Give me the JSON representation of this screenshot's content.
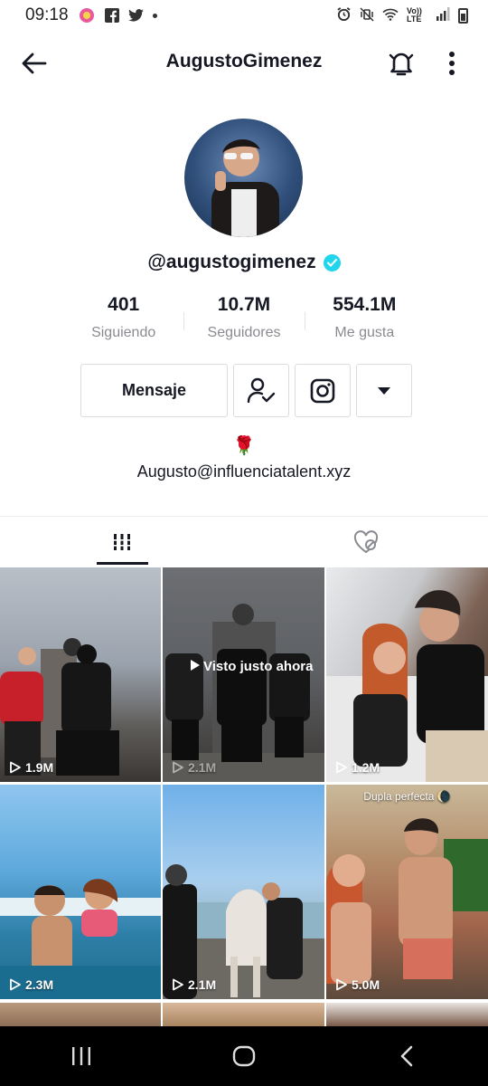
{
  "status_bar": {
    "time": "09:18",
    "network": "Vo)) LTE"
  },
  "header": {
    "title": "AugustoGimenez"
  },
  "profile": {
    "handle": "@augustogimenez",
    "verified": true
  },
  "stats": [
    {
      "value": "401",
      "label": "Siguiendo"
    },
    {
      "value": "10.7M",
      "label": "Seguidores"
    },
    {
      "value": "554.1M",
      "label": "Me gusta"
    }
  ],
  "actions": {
    "message_label": "Mensaje"
  },
  "bio": {
    "emoji": "🌹",
    "email": "Augusto@influenciatalent.xyz"
  },
  "videos": [
    {
      "views": "1.9M",
      "bg": "linear-gradient(180deg,#b9bfc7 0%,#9aa2ad 45%,#5d5b58 75%,#3a3633 100%)"
    },
    {
      "views": "2.1M",
      "bg": "linear-gradient(180deg,#a7aab0 0%,#8f9399 50%,#6e6c6a 80%,#5b5856 100%)",
      "watched_text": "Visto justo ahora"
    },
    {
      "views": "1.2M",
      "bg": "linear-gradient(120deg,#e8eaec 0%,#c7c9cc 35%,#7d6355 60%,#3b2e29 100%)"
    },
    {
      "views": "2.3M",
      "bg": "linear-gradient(180deg,#8fc6ef 0%,#5ea9dc 40%,#2e7fa8 70%,#1f6b8c 100%)"
    },
    {
      "views": "2.1M",
      "bg": "linear-gradient(180deg,#6fb0e8 0%,#a9cfee 45%,#9bb7c8 65%,#4a4d52 100%)"
    },
    {
      "views": "5.0M",
      "bg": "linear-gradient(180deg,#c9b99a 0%,#b48c6a 35%,#a2664c 65%,#5e4a3c 100%)",
      "caption": "Dupla perfecta 🌘"
    }
  ]
}
